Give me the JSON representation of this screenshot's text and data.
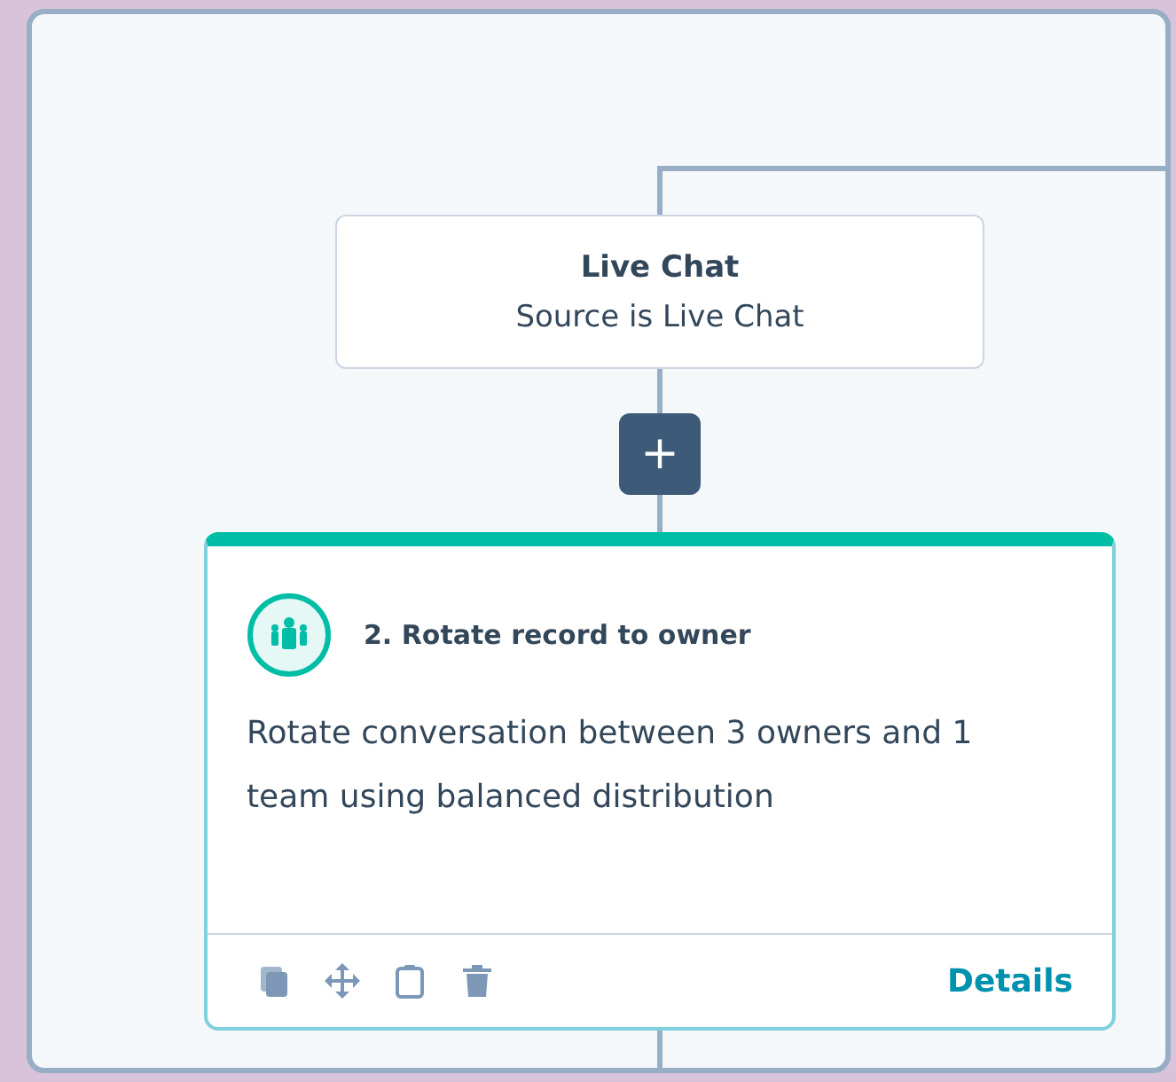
{
  "trigger_node": {
    "title": "Live Chat",
    "subtitle": "Source is Live Chat"
  },
  "add_button": {
    "label": "+"
  },
  "action_card": {
    "title": "2. Rotate record to owner",
    "description": "Rotate conversation between 3 owners and 1 team using balanced distribution",
    "details_link": "Details"
  }
}
